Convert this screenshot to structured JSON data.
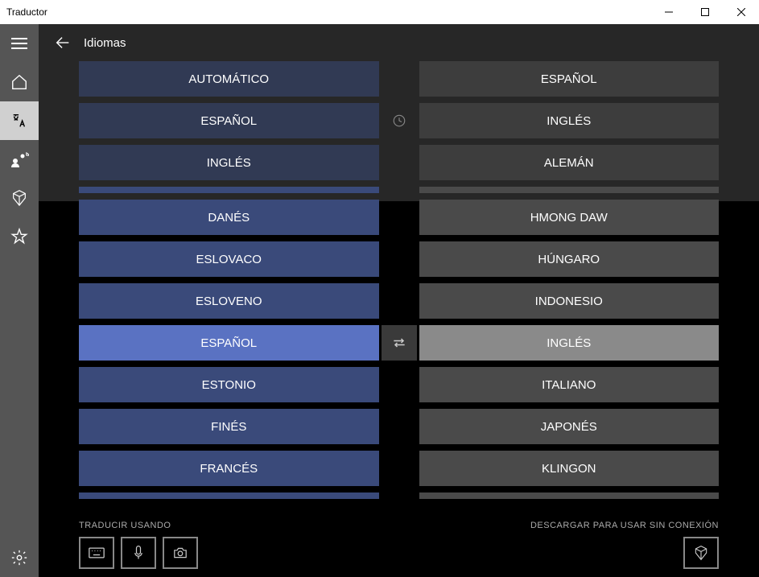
{
  "window": {
    "title": "Traductor"
  },
  "header": {
    "title": "Idiomas"
  },
  "source_top": [
    "AUTOMÁTICO",
    "ESPAÑOL",
    "INGLÉS"
  ],
  "source_list": [
    "DANÉS",
    "ESLOVACO",
    "ESLOVENO",
    "ESPAÑOL",
    "ESTONIO",
    "FINÉS",
    "FRANCÉS"
  ],
  "source_selected": "ESPAÑOL",
  "target_top": [
    "ESPAÑOL",
    "INGLÉS",
    "ALEMÁN"
  ],
  "target_list": [
    "HMONG DAW",
    "HÚNGARO",
    "INDONESIO",
    "INGLÉS",
    "ITALIANO",
    "JAPONÉS",
    "KLINGON"
  ],
  "target_selected": "INGLÉS",
  "footer": {
    "left_label": "TRADUCIR USANDO",
    "right_label": "DESCARGAR PARA USAR SIN CONEXIÓN"
  }
}
